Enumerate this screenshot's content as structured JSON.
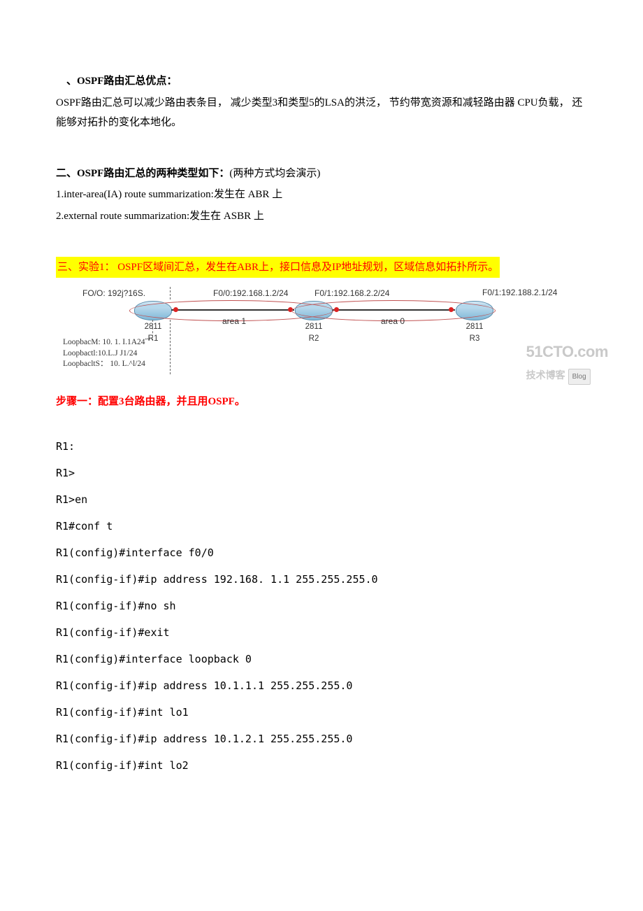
{
  "section1": {
    "heading": "、OSPF路由汇总优点：",
    "body": "OSPF路由汇总可以减少路由表条目， 减少类型3和类型5的LSA的洪泛， 节约带宽资源和减轻路由器 CPU负载， 还能够对拓扑的变化本地化。"
  },
  "section2": {
    "heading": "二、OSPF路由汇总的两种类型如下：",
    "note": "(两种方式均会演示)",
    "item1": "1.inter-area(IA) route summarization:发生在 ABR 上",
    "item2": "2.external route summarization:发生在 ASBR 上"
  },
  "section3": {
    "heading": "三、实验1：  OSPF区域间汇总，发生在ABR上，接口信息及IP地址规划，区域信息如拓扑所示。"
  },
  "topology": {
    "r1": {
      "model": "2811",
      "name": "R1",
      "f00": "FO/O: 192j?16S."
    },
    "r2": {
      "model": "2811",
      "name": "R2",
      "f00": "F0/0:192.168.1.2/24",
      "f01": "F0/1:192.168.2.2/24"
    },
    "r3": {
      "model": "2811",
      "name": "R3",
      "f01": "F0/1:192.188.2.1/24"
    },
    "area1": "area 1",
    "area0": "area 0",
    "loopbacks": {
      "l0": "LoopbacM: 10. 1. I.1A24˝ˇ",
      "l1": "Loopbactl:10.L.J J1/24",
      "l2": "LoopbacltS： 10. L.^l/24"
    }
  },
  "step1": {
    "title": "步骤一：配置3台路由器，并且用OSPF。"
  },
  "cli": {
    "r1_label": "R1:",
    "lines": [
      "R1>",
      "R1>en",
      "R1#conf t",
      "R1(config)#interface f0/0",
      "R1(config-if)#ip address 192.168. 1.1 255.255.255.0",
      "R1(config-if)#no sh",
      "R1(config-if)#exit",
      "R1(config)#interface loopback 0",
      "R1(config-if)#ip address 10.1.1.1 255.255.255.0",
      "R1(config-if)#int lo1",
      "R1(config-if)#ip address 10.1.2.1 255.255.255.0",
      "R1(config-if)#int lo2"
    ]
  },
  "watermark": {
    "big": "51CTO.com",
    "small": "技术博客",
    "badge": "Blog"
  }
}
